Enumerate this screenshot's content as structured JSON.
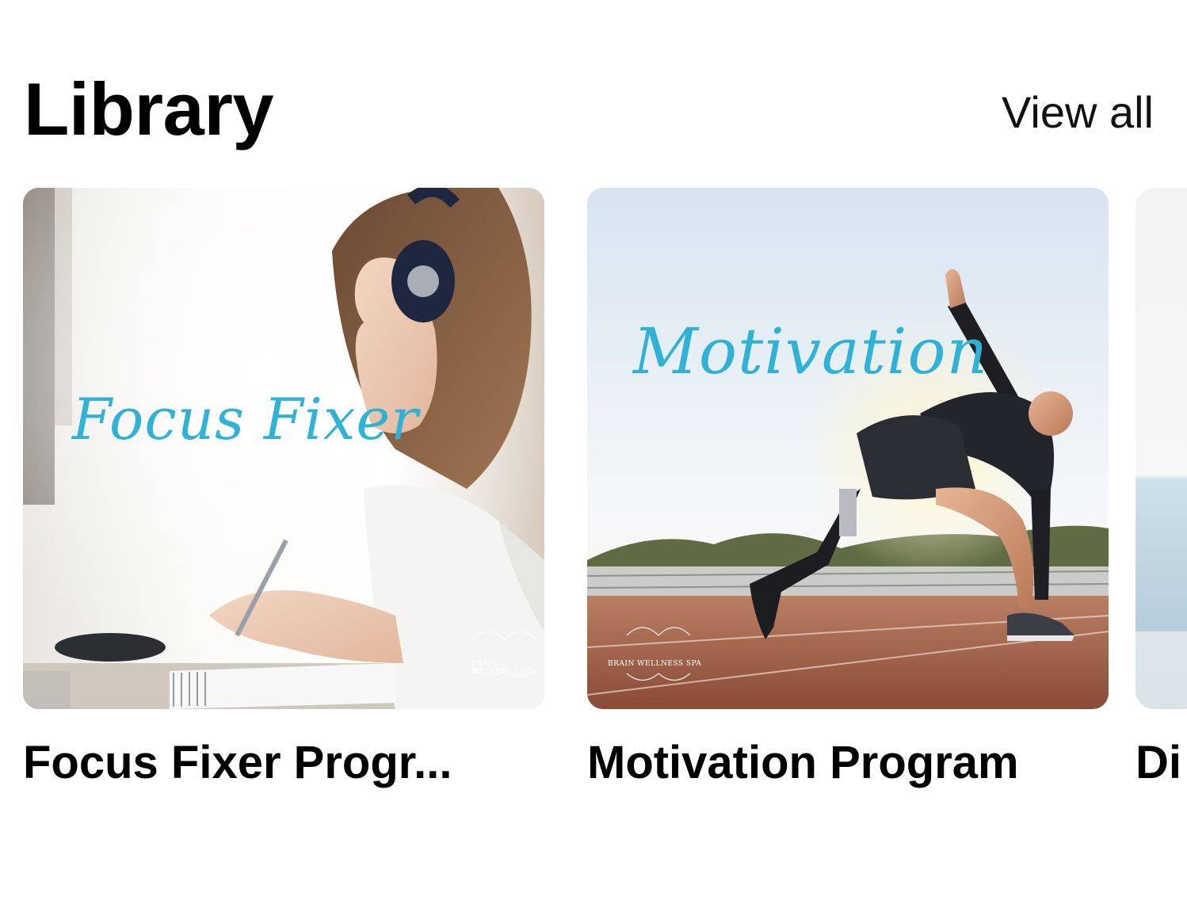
{
  "header": {
    "title": "Library",
    "view_all_label": "View all"
  },
  "cards": [
    {
      "title": "Focus Fixer Progr...",
      "art_text": "Focus Fixer",
      "brand_text": "BRAIN WELLNESS SPA"
    },
    {
      "title": "Motivation Program",
      "art_text": "Motivation",
      "brand_text": "BRAIN WELLNESS SPA"
    },
    {
      "title": "Di"
    }
  ],
  "colors": {
    "script_accent": "#2fb2d6",
    "text": "#000000",
    "background": "#ffffff"
  }
}
